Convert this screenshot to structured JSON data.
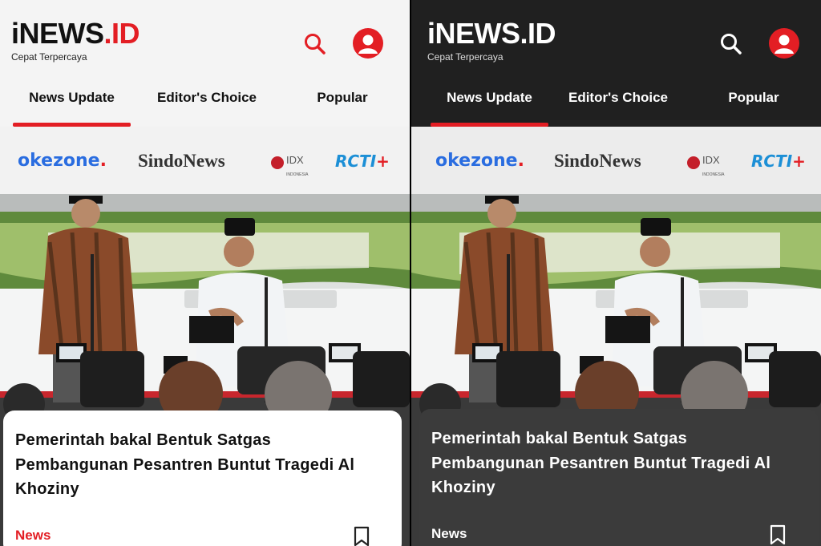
{
  "header": {
    "logo_main": "iNEWS",
    "logo_suffix": ".ID",
    "tagline": "Cepat Terpercaya",
    "search_icon": "search-icon",
    "profile_icon": "user-circle-icon"
  },
  "tabs": [
    {
      "label": "News Update",
      "active": true
    },
    {
      "label": "Editor's Choice",
      "active": false
    },
    {
      "label": "Popular",
      "active": false
    }
  ],
  "partners": {
    "okezone": "okezone",
    "okezone_dot": ".",
    "sindonews": "SindoNews",
    "idx": "IDX",
    "idx_sub": "INDONESIA",
    "rcti": "RCTI",
    "rcti_plus": "+"
  },
  "article": {
    "title": "Pemerintah bakal Bentuk Satgas Pembangunan Pesantren Buntut Tragedi Al Khoziny",
    "category": "News",
    "bookmark_icon": "bookmark-icon"
  },
  "colors": {
    "accent": "#e31e24",
    "light_bg": "#f4f4f4",
    "dark_bg": "#202020",
    "dark_card": "#3b3b3b"
  }
}
